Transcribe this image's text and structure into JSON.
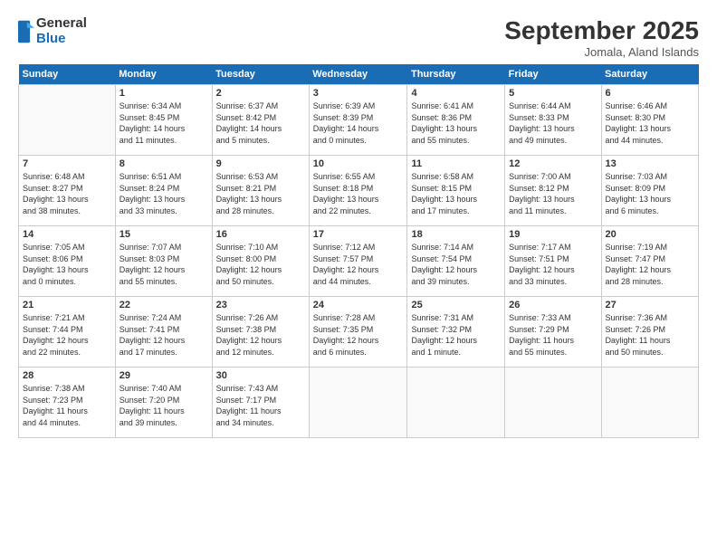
{
  "logo": {
    "general": "General",
    "blue": "Blue"
  },
  "title": "September 2025",
  "location": "Jomala, Aland Islands",
  "days_header": [
    "Sunday",
    "Monday",
    "Tuesday",
    "Wednesday",
    "Thursday",
    "Friday",
    "Saturday"
  ],
  "weeks": [
    [
      {
        "day": "",
        "info": ""
      },
      {
        "day": "1",
        "info": "Sunrise: 6:34 AM\nSunset: 8:45 PM\nDaylight: 14 hours\nand 11 minutes."
      },
      {
        "day": "2",
        "info": "Sunrise: 6:37 AM\nSunset: 8:42 PM\nDaylight: 14 hours\nand 5 minutes."
      },
      {
        "day": "3",
        "info": "Sunrise: 6:39 AM\nSunset: 8:39 PM\nDaylight: 14 hours\nand 0 minutes."
      },
      {
        "day": "4",
        "info": "Sunrise: 6:41 AM\nSunset: 8:36 PM\nDaylight: 13 hours\nand 55 minutes."
      },
      {
        "day": "5",
        "info": "Sunrise: 6:44 AM\nSunset: 8:33 PM\nDaylight: 13 hours\nand 49 minutes."
      },
      {
        "day": "6",
        "info": "Sunrise: 6:46 AM\nSunset: 8:30 PM\nDaylight: 13 hours\nand 44 minutes."
      }
    ],
    [
      {
        "day": "7",
        "info": "Sunrise: 6:48 AM\nSunset: 8:27 PM\nDaylight: 13 hours\nand 38 minutes."
      },
      {
        "day": "8",
        "info": "Sunrise: 6:51 AM\nSunset: 8:24 PM\nDaylight: 13 hours\nand 33 minutes."
      },
      {
        "day": "9",
        "info": "Sunrise: 6:53 AM\nSunset: 8:21 PM\nDaylight: 13 hours\nand 28 minutes."
      },
      {
        "day": "10",
        "info": "Sunrise: 6:55 AM\nSunset: 8:18 PM\nDaylight: 13 hours\nand 22 minutes."
      },
      {
        "day": "11",
        "info": "Sunrise: 6:58 AM\nSunset: 8:15 PM\nDaylight: 13 hours\nand 17 minutes."
      },
      {
        "day": "12",
        "info": "Sunrise: 7:00 AM\nSunset: 8:12 PM\nDaylight: 13 hours\nand 11 minutes."
      },
      {
        "day": "13",
        "info": "Sunrise: 7:03 AM\nSunset: 8:09 PM\nDaylight: 13 hours\nand 6 minutes."
      }
    ],
    [
      {
        "day": "14",
        "info": "Sunrise: 7:05 AM\nSunset: 8:06 PM\nDaylight: 13 hours\nand 0 minutes."
      },
      {
        "day": "15",
        "info": "Sunrise: 7:07 AM\nSunset: 8:03 PM\nDaylight: 12 hours\nand 55 minutes."
      },
      {
        "day": "16",
        "info": "Sunrise: 7:10 AM\nSunset: 8:00 PM\nDaylight: 12 hours\nand 50 minutes."
      },
      {
        "day": "17",
        "info": "Sunrise: 7:12 AM\nSunset: 7:57 PM\nDaylight: 12 hours\nand 44 minutes."
      },
      {
        "day": "18",
        "info": "Sunrise: 7:14 AM\nSunset: 7:54 PM\nDaylight: 12 hours\nand 39 minutes."
      },
      {
        "day": "19",
        "info": "Sunrise: 7:17 AM\nSunset: 7:51 PM\nDaylight: 12 hours\nand 33 minutes."
      },
      {
        "day": "20",
        "info": "Sunrise: 7:19 AM\nSunset: 7:47 PM\nDaylight: 12 hours\nand 28 minutes."
      }
    ],
    [
      {
        "day": "21",
        "info": "Sunrise: 7:21 AM\nSunset: 7:44 PM\nDaylight: 12 hours\nand 22 minutes."
      },
      {
        "day": "22",
        "info": "Sunrise: 7:24 AM\nSunset: 7:41 PM\nDaylight: 12 hours\nand 17 minutes."
      },
      {
        "day": "23",
        "info": "Sunrise: 7:26 AM\nSunset: 7:38 PM\nDaylight: 12 hours\nand 12 minutes."
      },
      {
        "day": "24",
        "info": "Sunrise: 7:28 AM\nSunset: 7:35 PM\nDaylight: 12 hours\nand 6 minutes."
      },
      {
        "day": "25",
        "info": "Sunrise: 7:31 AM\nSunset: 7:32 PM\nDaylight: 12 hours\nand 1 minute."
      },
      {
        "day": "26",
        "info": "Sunrise: 7:33 AM\nSunset: 7:29 PM\nDaylight: 11 hours\nand 55 minutes."
      },
      {
        "day": "27",
        "info": "Sunrise: 7:36 AM\nSunset: 7:26 PM\nDaylight: 11 hours\nand 50 minutes."
      }
    ],
    [
      {
        "day": "28",
        "info": "Sunrise: 7:38 AM\nSunset: 7:23 PM\nDaylight: 11 hours\nand 44 minutes."
      },
      {
        "day": "29",
        "info": "Sunrise: 7:40 AM\nSunset: 7:20 PM\nDaylight: 11 hours\nand 39 minutes."
      },
      {
        "day": "30",
        "info": "Sunrise: 7:43 AM\nSunset: 7:17 PM\nDaylight: 11 hours\nand 34 minutes."
      },
      {
        "day": "",
        "info": ""
      },
      {
        "day": "",
        "info": ""
      },
      {
        "day": "",
        "info": ""
      },
      {
        "day": "",
        "info": ""
      }
    ]
  ]
}
